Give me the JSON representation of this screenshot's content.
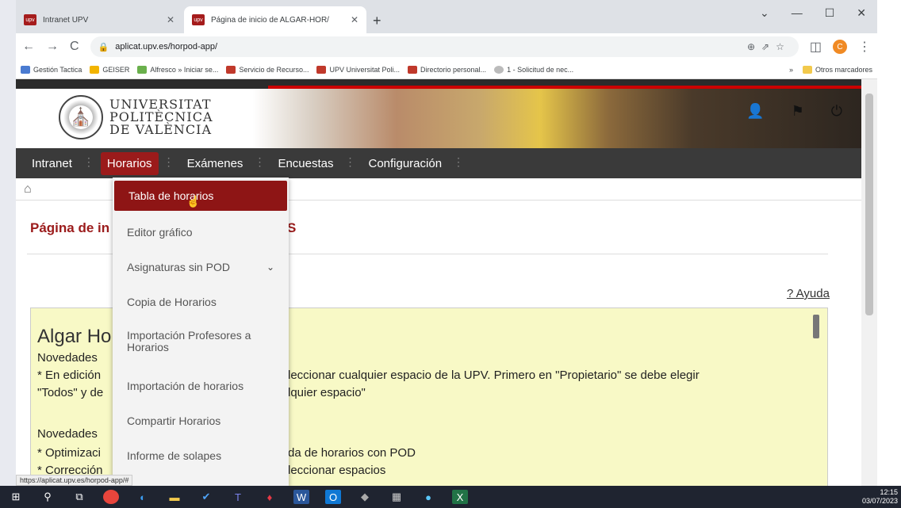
{
  "browser": {
    "tabs": [
      {
        "label": "Intranet UPV",
        "favicon": "upv"
      },
      {
        "label": "Página de inicio de ALGAR-HOR/",
        "favicon": "upv"
      }
    ],
    "new_tab": "+",
    "url": "aplicat.upv.es/horpod-app/",
    "profile_initial": "C",
    "bookmarks": [
      "Gestión Tactica",
      "GEISER",
      "Alfresco » Iniciar se...",
      "Servicio de Recurso...",
      "UPV Universitat Poli...",
      "Directorio personal...",
      "1 - Solicitud de nec..."
    ],
    "bookmarks_more": "»",
    "other_bookmarks": "Otros marcadores",
    "status_url": "https://aplicat.upv.es/horpod-app/#"
  },
  "header": {
    "logo_line1": "UNIVERSITAT",
    "logo_line2": "POLITÈCNICA",
    "logo_line3": "DE VALÈNCIA"
  },
  "nav": {
    "items": [
      "Intranet",
      "Horarios",
      "Exámenes",
      "Encuestas",
      "Configuración"
    ],
    "active": "Horarios"
  },
  "dropdown": {
    "items": [
      "Tabla de horarios",
      "Editor gráfico",
      "Asignaturas sin POD",
      "Copia de Horarios",
      "Importación Profesores a Horarios",
      "Importación de horarios",
      "Compartir Horarios",
      "Informe de solapes"
    ]
  },
  "page": {
    "title_start": "Página de in",
    "title_end": "S",
    "help": "? Ayuda",
    "panel_heading": "Algar Ho",
    "lines_left": [
      "Novedades",
      "* En edición",
      "\"Todos\" y de",
      "Novedades",
      "* Optimizaci",
      "* Corrección"
    ],
    "lines_right": [
      "leccionar cualquier espacio de la UPV. Primero en \"Propietario\" se debe elegir",
      "lquier espacio\"",
      "da de horarios con POD",
      "leccionar espacios"
    ]
  },
  "taskbar": {
    "time": "12:15",
    "date": "03/07/2023"
  },
  "colors": {
    "brand_red": "#9b1b1b",
    "nav_bg": "#3a3a3a",
    "panel_bg": "#f8f9c6"
  }
}
